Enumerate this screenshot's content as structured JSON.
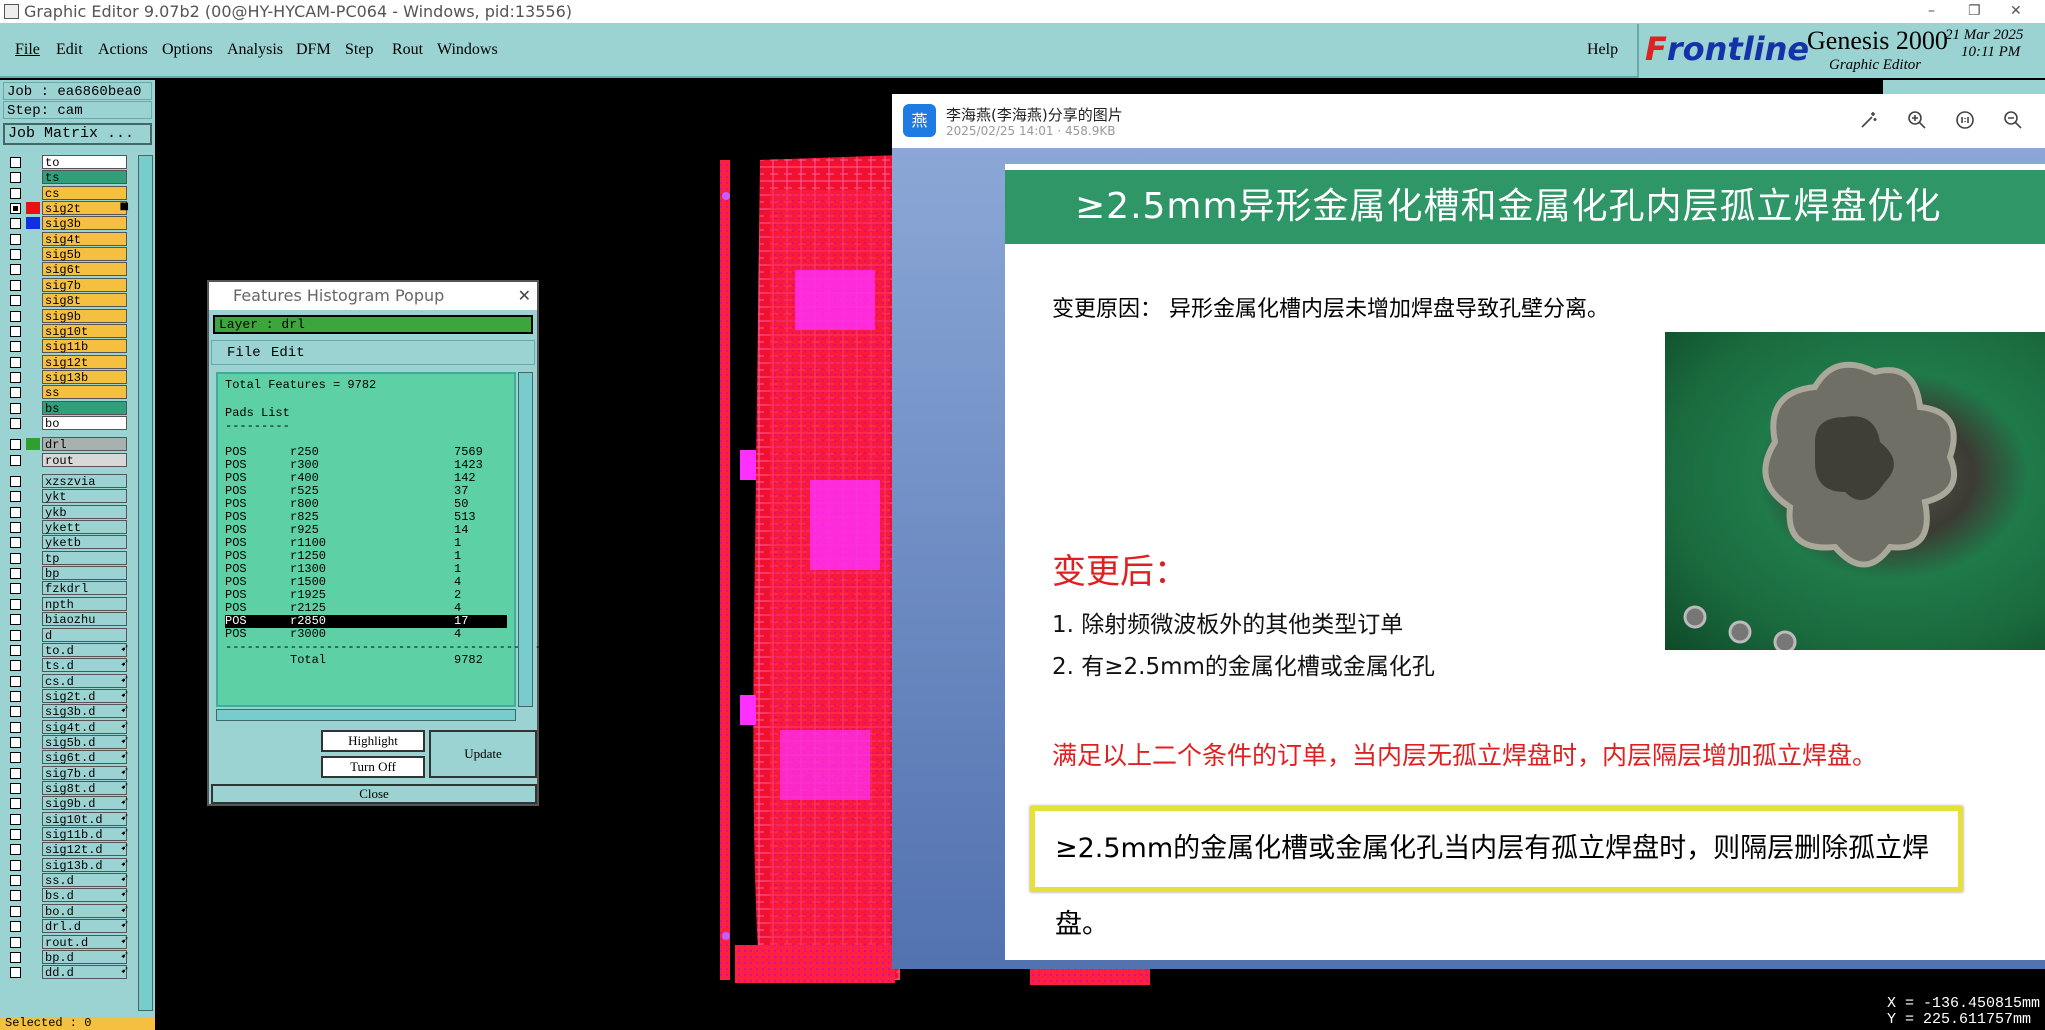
{
  "window": {
    "title": "Graphic Editor 9.07b2 (00@HY-HYCAM-PC064 - Windows, pid:13556)",
    "min": "–",
    "max": "❐",
    "close": "✕"
  },
  "menu": {
    "file": "File",
    "edit": "Edit",
    "actions": "Actions",
    "options": "Options",
    "analysis": "Analysis",
    "dfm": "DFM",
    "step": "Step",
    "rout": "Rout",
    "windows": "Windows",
    "help": "Help"
  },
  "brand": {
    "logo_prefix": "F",
    "logo_rest": "rontline",
    "product": "Genesis 2000",
    "subtitle": "Graphic Editor",
    "date": "21 Mar 2025",
    "time": "10:11 PM"
  },
  "job": {
    "job": "Job : ea6860bea0",
    "step": "Step: cam",
    "matrix_button": "Job Matrix ..."
  },
  "layers": [
    {
      "name": "to",
      "color": "#ffffff",
      "checked": false,
      "swatch": ""
    },
    {
      "name": "ts",
      "color": "#2fa07a",
      "checked": false,
      "swatch": ""
    },
    {
      "name": "cs",
      "color": "#f5c040",
      "checked": false,
      "swatch": ""
    },
    {
      "name": "sig2t",
      "color": "#f5c040",
      "checked": true,
      "swatch": "#e81010",
      "mark": "■"
    },
    {
      "name": "sig3b",
      "color": "#f5c040",
      "checked": false,
      "swatch": "#1030e0"
    },
    {
      "name": "sig4t",
      "color": "#f5c040",
      "checked": false,
      "swatch": ""
    },
    {
      "name": "sig5b",
      "color": "#f5c040",
      "checked": false,
      "swatch": ""
    },
    {
      "name": "sig6t",
      "color": "#f5c040",
      "checked": false,
      "swatch": ""
    },
    {
      "name": "sig7b",
      "color": "#f5c040",
      "checked": false,
      "swatch": ""
    },
    {
      "name": "sig8t",
      "color": "#f5c040",
      "checked": false,
      "swatch": ""
    },
    {
      "name": "sig9b",
      "color": "#f5c040",
      "checked": false,
      "swatch": ""
    },
    {
      "name": "sig10t",
      "color": "#f5c040",
      "checked": false,
      "swatch": ""
    },
    {
      "name": "sig11b",
      "color": "#f5c040",
      "checked": false,
      "swatch": ""
    },
    {
      "name": "sig12t",
      "color": "#f5c040",
      "checked": false,
      "swatch": ""
    },
    {
      "name": "sig13b",
      "color": "#f5c040",
      "checked": false,
      "swatch": ""
    },
    {
      "name": "ss",
      "color": "#f5c040",
      "checked": false,
      "swatch": ""
    },
    {
      "name": "bs",
      "color": "#2fa07a",
      "checked": false,
      "swatch": ""
    },
    {
      "name": "bo",
      "color": "#ffffff",
      "checked": false,
      "swatch": ""
    },
    {
      "name": "drl",
      "color": "#a9b0b0",
      "checked": false,
      "swatch": "#2fa02f",
      "gap": true
    },
    {
      "name": "rout",
      "color": "#d8d8d8",
      "checked": false,
      "swatch": ""
    },
    {
      "name": "xzszvia",
      "color": "#9bd3d3",
      "checked": false,
      "swatch": "",
      "gap": true
    },
    {
      "name": "ykt",
      "color": "#9bd3d3",
      "checked": false,
      "swatch": ""
    },
    {
      "name": "ykb",
      "color": "#9bd3d3",
      "checked": false,
      "swatch": ""
    },
    {
      "name": "ykett",
      "color": "#9bd3d3",
      "checked": false,
      "swatch": ""
    },
    {
      "name": "yketb",
      "color": "#9bd3d3",
      "checked": false,
      "swatch": ""
    },
    {
      "name": "tp",
      "color": "#9bd3d3",
      "checked": false,
      "swatch": ""
    },
    {
      "name": "bp",
      "color": "#9bd3d3",
      "checked": false,
      "swatch": ""
    },
    {
      "name": "fzkdrl",
      "color": "#9bd3d3",
      "checked": false,
      "swatch": ""
    },
    {
      "name": "npth",
      "color": "#9bd3d3",
      "checked": false,
      "swatch": ""
    },
    {
      "name": "biaozhu",
      "color": "#9bd3d3",
      "checked": false,
      "swatch": ""
    },
    {
      "name": "d",
      "color": "#9bd3d3",
      "checked": false,
      "swatch": ""
    },
    {
      "name": "to.d",
      "color": "#9bd3d3",
      "checked": false,
      "swatch": "",
      "mark": "➹"
    },
    {
      "name": "ts.d",
      "color": "#9bd3d3",
      "checked": false,
      "swatch": "",
      "mark": "➹"
    },
    {
      "name": "cs.d",
      "color": "#9bd3d3",
      "checked": false,
      "swatch": "",
      "mark": "➹"
    },
    {
      "name": "sig2t.d",
      "color": "#9bd3d3",
      "checked": false,
      "swatch": "",
      "mark": "➹"
    },
    {
      "name": "sig3b.d",
      "color": "#9bd3d3",
      "checked": false,
      "swatch": "",
      "mark": "➹"
    },
    {
      "name": "sig4t.d",
      "color": "#9bd3d3",
      "checked": false,
      "swatch": "",
      "mark": "➹"
    },
    {
      "name": "sig5b.d",
      "color": "#9bd3d3",
      "checked": false,
      "swatch": "",
      "mark": "➹"
    },
    {
      "name": "sig6t.d",
      "color": "#9bd3d3",
      "checked": false,
      "swatch": "",
      "mark": "➹"
    },
    {
      "name": "sig7b.d",
      "color": "#9bd3d3",
      "checked": false,
      "swatch": "",
      "mark": "➹"
    },
    {
      "name": "sig8t.d",
      "color": "#9bd3d3",
      "checked": false,
      "swatch": "",
      "mark": "➹"
    },
    {
      "name": "sig9b.d",
      "color": "#9bd3d3",
      "checked": false,
      "swatch": "",
      "mark": "➹"
    },
    {
      "name": "sig10t.d",
      "color": "#9bd3d3",
      "checked": false,
      "swatch": "",
      "mark": "➹"
    },
    {
      "name": "sig11b.d",
      "color": "#9bd3d3",
      "checked": false,
      "swatch": "",
      "mark": "➹"
    },
    {
      "name": "sig12t.d",
      "color": "#9bd3d3",
      "checked": false,
      "swatch": "",
      "mark": "➹"
    },
    {
      "name": "sig13b.d",
      "color": "#9bd3d3",
      "checked": false,
      "swatch": "",
      "mark": "➹"
    },
    {
      "name": "ss.d",
      "color": "#9bd3d3",
      "checked": false,
      "swatch": "",
      "mark": "➹"
    },
    {
      "name": "bs.d",
      "color": "#9bd3d3",
      "checked": false,
      "swatch": "",
      "mark": "➹"
    },
    {
      "name": "bo.d",
      "color": "#9bd3d3",
      "checked": false,
      "swatch": "",
      "mark": "➹"
    },
    {
      "name": "drl.d",
      "color": "#9bd3d3",
      "checked": false,
      "swatch": "",
      "mark": "➹"
    },
    {
      "name": "rout.d",
      "color": "#9bd3d3",
      "checked": false,
      "swatch": "",
      "mark": "➹"
    },
    {
      "name": "bp.d",
      "color": "#9bd3d3",
      "checked": false,
      "swatch": "",
      "mark": "➹"
    },
    {
      "name": "dd.d",
      "color": "#9bd3d3",
      "checked": false,
      "swatch": "",
      "mark": "➹"
    }
  ],
  "status": {
    "selected": "Selected : 0"
  },
  "histogram": {
    "title": "Features Histogram Popup",
    "close": "✕",
    "layer": "Layer :  drl",
    "menu_file": "File",
    "menu_edit": "Edit",
    "total_features": "Total Features = 9782",
    "section": "Pads List",
    "underline": "---------",
    "rows": [
      {
        "type": "POS",
        "sym": "r250",
        "count": "7569"
      },
      {
        "type": "POS",
        "sym": "r300",
        "count": "1423"
      },
      {
        "type": "POS",
        "sym": "r400",
        "count": "142"
      },
      {
        "type": "POS",
        "sym": "r525",
        "count": "37"
      },
      {
        "type": "POS",
        "sym": "r800",
        "count": "50"
      },
      {
        "type": "POS",
        "sym": "r825",
        "count": "513"
      },
      {
        "type": "POS",
        "sym": "r925",
        "count": "14"
      },
      {
        "type": "POS",
        "sym": "r1100",
        "count": "1"
      },
      {
        "type": "POS",
        "sym": "r1250",
        "count": "1"
      },
      {
        "type": "POS",
        "sym": "r1300",
        "count": "1"
      },
      {
        "type": "POS",
        "sym": "r1500",
        "count": "4"
      },
      {
        "type": "POS",
        "sym": "r1925",
        "count": "2"
      },
      {
        "type": "POS",
        "sym": "r2125",
        "count": "4"
      },
      {
        "type": "POS",
        "sym": "r2850",
        "count": "17",
        "selected": true
      },
      {
        "type": "POS",
        "sym": "r3000",
        "count": "4"
      }
    ],
    "divider": "--------------------------------------------",
    "total_label": "Total",
    "total_value": "9782",
    "btn_highlight": "Highlight",
    "btn_turnoff": "Turn Off",
    "btn_update": "Update",
    "btn_close": "Close"
  },
  "viewer": {
    "avatar": "燕",
    "sender": "李海燕(李海燕)分享的图片",
    "meta": "2025/02/25 14:01 · 458.9KB",
    "slide": {
      "title": "≥2.5mm异形金属化槽和金属化孔内层孤立焊盘优化",
      "reason": "变更原因： 异形金属化槽内层未增加焊盘导致孔壁分离。",
      "after": "变更后：",
      "item1": "1.  除射频微波板外的其他类型订单",
      "item2": "2.  有≥2.5mm的金属化槽或金属化孔",
      "condition": "满足以上二个条件的订单，当内层无孤立焊盘时，内层隔层增加孤立焊盘。",
      "boxed": "≥2.5mm的金属化槽或金属化孔当内层有孤立焊盘时，则隔层删除孤立焊盘。"
    }
  },
  "coords": {
    "x": "X = -136.450815mm",
    "y": "Y = 225.611757mm"
  }
}
